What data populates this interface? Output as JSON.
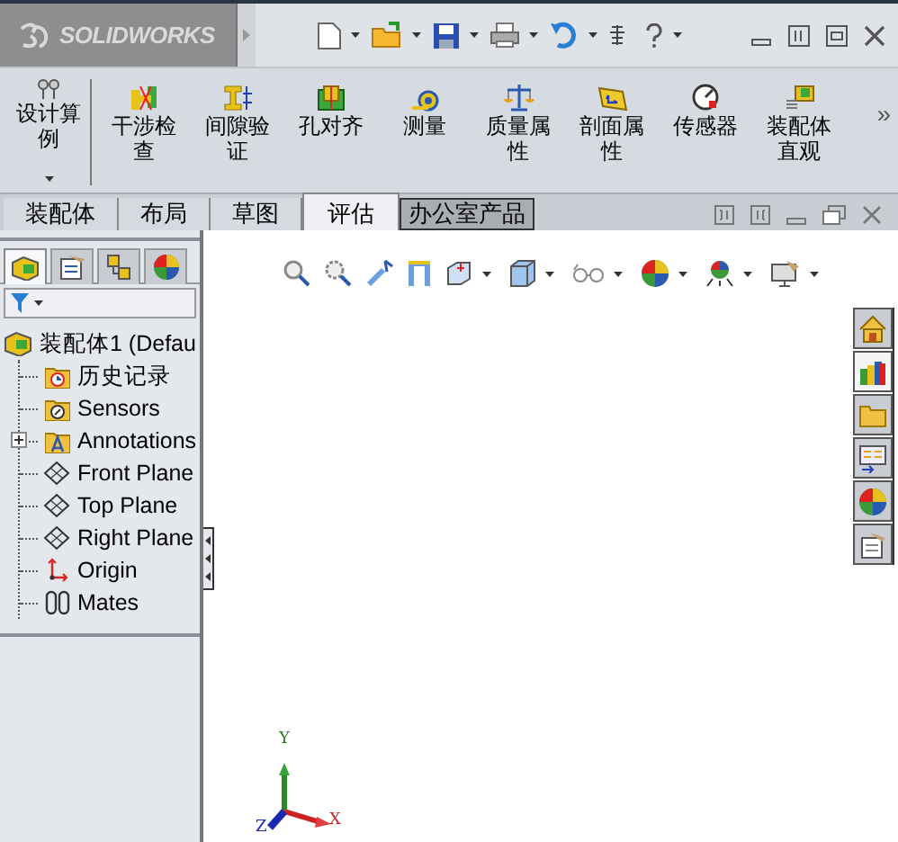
{
  "app": {
    "logo": "SOLIDWORKS"
  },
  "ribbon": {
    "study": {
      "label": "设计算例"
    },
    "tools": [
      {
        "label": "干涉检查"
      },
      {
        "label": "间隙验证"
      },
      {
        "label": "孔对齐"
      },
      {
        "label": "测量"
      },
      {
        "label": "质量属性"
      },
      {
        "label": "剖面属性"
      },
      {
        "label": "传感器"
      },
      {
        "label": "装配体直观"
      }
    ],
    "more": "»"
  },
  "tabs": [
    {
      "label": "装配体",
      "selected": false
    },
    {
      "label": "布局",
      "selected": false
    },
    {
      "label": "草图",
      "selected": false
    },
    {
      "label": "评估",
      "selected": true
    },
    {
      "label": "办公室产品",
      "selected": false
    }
  ],
  "panel_tabs": [
    {
      "kind": "feature",
      "selected": true
    },
    {
      "kind": "property",
      "selected": false
    },
    {
      "kind": "config",
      "selected": false
    },
    {
      "kind": "appearance",
      "selected": false
    }
  ],
  "feature_tree": {
    "root": {
      "label": "装配体1 (Defau",
      "children": [
        {
          "label": "历史记录",
          "kind": "history"
        },
        {
          "label": "Sensors",
          "kind": "sensors"
        },
        {
          "label": "Annotations",
          "kind": "annotations",
          "expanded": false
        },
        {
          "label": "Front Plane",
          "kind": "plane"
        },
        {
          "label": "Top Plane",
          "kind": "plane"
        },
        {
          "label": "Right Plane",
          "kind": "plane"
        },
        {
          "label": "Origin",
          "kind": "origin"
        },
        {
          "label": "Mates",
          "kind": "mates"
        }
      ]
    }
  },
  "task_pane": [
    {
      "kind": "home",
      "selected": false
    },
    {
      "kind": "library",
      "selected": true
    },
    {
      "kind": "files",
      "selected": false
    },
    {
      "kind": "views",
      "selected": false
    },
    {
      "kind": "appearance",
      "selected": false
    },
    {
      "kind": "properties",
      "selected": false
    }
  ],
  "triad": {
    "y": "Y",
    "x": "X",
    "z": "Z"
  }
}
